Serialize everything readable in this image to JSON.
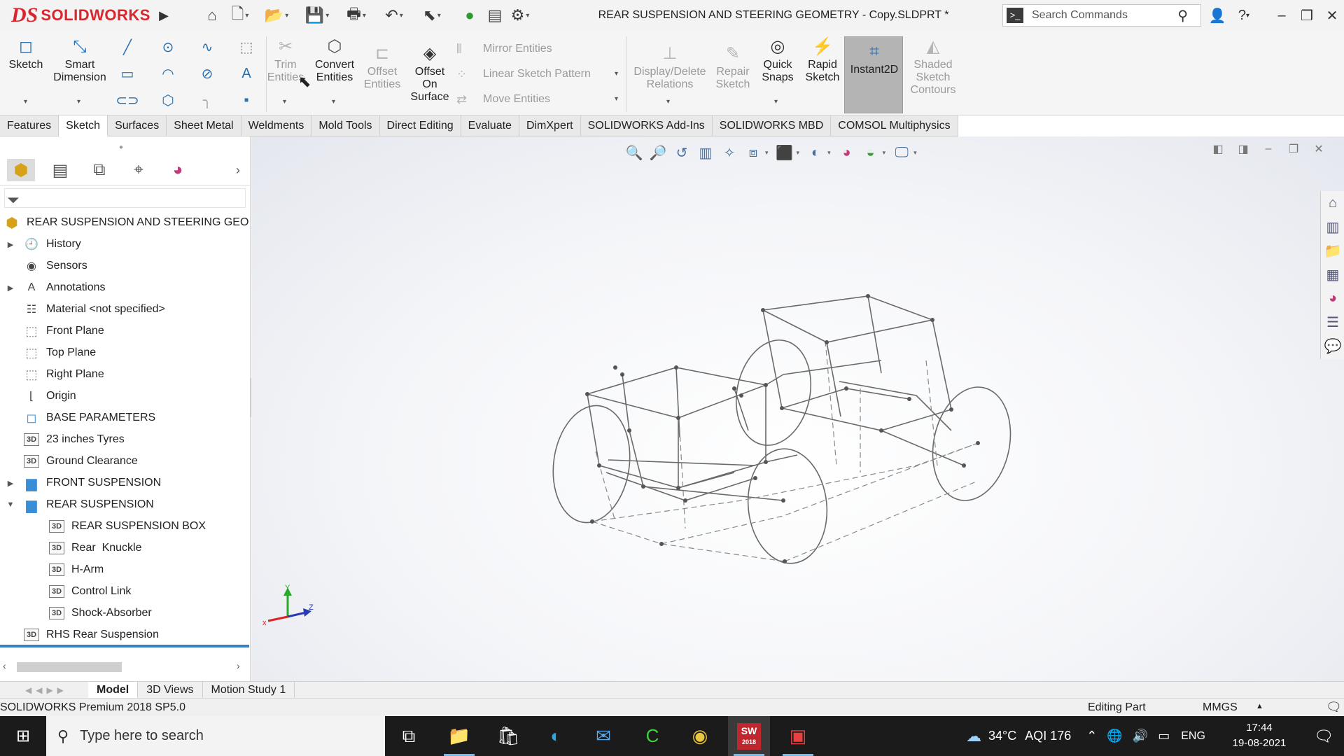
{
  "app": {
    "logo_mark": "DS",
    "logo_text": "SOLIDWORKS",
    "document_title": "REAR SUSPENSION AND STEERING GEOMETRY - Copy.SLDPRT *",
    "search_placeholder": "Search Commands"
  },
  "command_manager": {
    "sketch": "Sketch",
    "smart_dimension_1": "Smart",
    "smart_dimension_2": "Dimension",
    "trim_1": "Trim",
    "trim_2": "Entities",
    "convert_1": "Convert",
    "convert_2": "Entities",
    "offset_1": "Offset",
    "offset_2": "Entities",
    "offset_surface_1": "Offset",
    "offset_surface_2": "On",
    "offset_surface_3": "Surface",
    "mirror": "Mirror Entities",
    "linear_pattern": "Linear Sketch Pattern",
    "move": "Move Entities",
    "display_relations_1": "Display/Delete",
    "display_relations_2": "Relations",
    "repair_1": "Repair",
    "repair_2": "Sketch",
    "quick_snaps_1": "Quick",
    "quick_snaps_2": "Snaps",
    "rapid_1": "Rapid",
    "rapid_2": "Sketch",
    "instant2d": "Instant2D",
    "shaded_1": "Shaded",
    "shaded_2": "Sketch",
    "shaded_3": "Contours"
  },
  "tabs": [
    "Features",
    "Sketch",
    "Surfaces",
    "Sheet Metal",
    "Weldments",
    "Mold Tools",
    "Direct Editing",
    "Evaluate",
    "DimXpert",
    "SOLIDWORKS Add-Ins",
    "SOLIDWORKS MBD",
    "COMSOL Multiphysics"
  ],
  "active_tab": "Sketch",
  "tree": {
    "root": "REAR SUSPENSION AND STEERING GEOMETRY",
    "items": [
      {
        "label": "History"
      },
      {
        "label": "Sensors"
      },
      {
        "label": "Annotations"
      },
      {
        "label": "Material <not specified>"
      },
      {
        "label": "Front Plane"
      },
      {
        "label": "Top Plane"
      },
      {
        "label": "Right Plane"
      },
      {
        "label": "Origin"
      },
      {
        "label": "BASE PARAMETERS"
      },
      {
        "label": "23 inches Tyres"
      },
      {
        "label": "Ground Clearance"
      },
      {
        "label": "FRONT SUSPENSION"
      },
      {
        "label": "REAR SUSPENSION"
      },
      {
        "label": "REAR SUSPENSION BOX"
      },
      {
        "label": "Rear  Knuckle"
      },
      {
        "label": "H-Arm"
      },
      {
        "label": "Control Link"
      },
      {
        "label": "Shock-Absorber"
      },
      {
        "label": "RHS Rear Suspension"
      }
    ]
  },
  "triad": {
    "x": "x",
    "y": "Y",
    "z": "Z"
  },
  "bottom_tabs": [
    "Model",
    "3D Views",
    "Motion Study 1"
  ],
  "status": {
    "version": "SOLIDWORKS Premium 2018 SP5.0",
    "mode": "Editing Part",
    "units": "MMGS"
  },
  "taskbar": {
    "search_placeholder": "Type here to search",
    "sw_badge": "2018",
    "temperature": "34°C",
    "aqi": "AQI 176",
    "language": "ENG",
    "time": "17:44",
    "date": "19-08-2021"
  },
  "colors": {
    "brand_red": "#d9262e",
    "accent_blue": "#2a6fb0",
    "instant2d_active": "#b4b4b4"
  }
}
